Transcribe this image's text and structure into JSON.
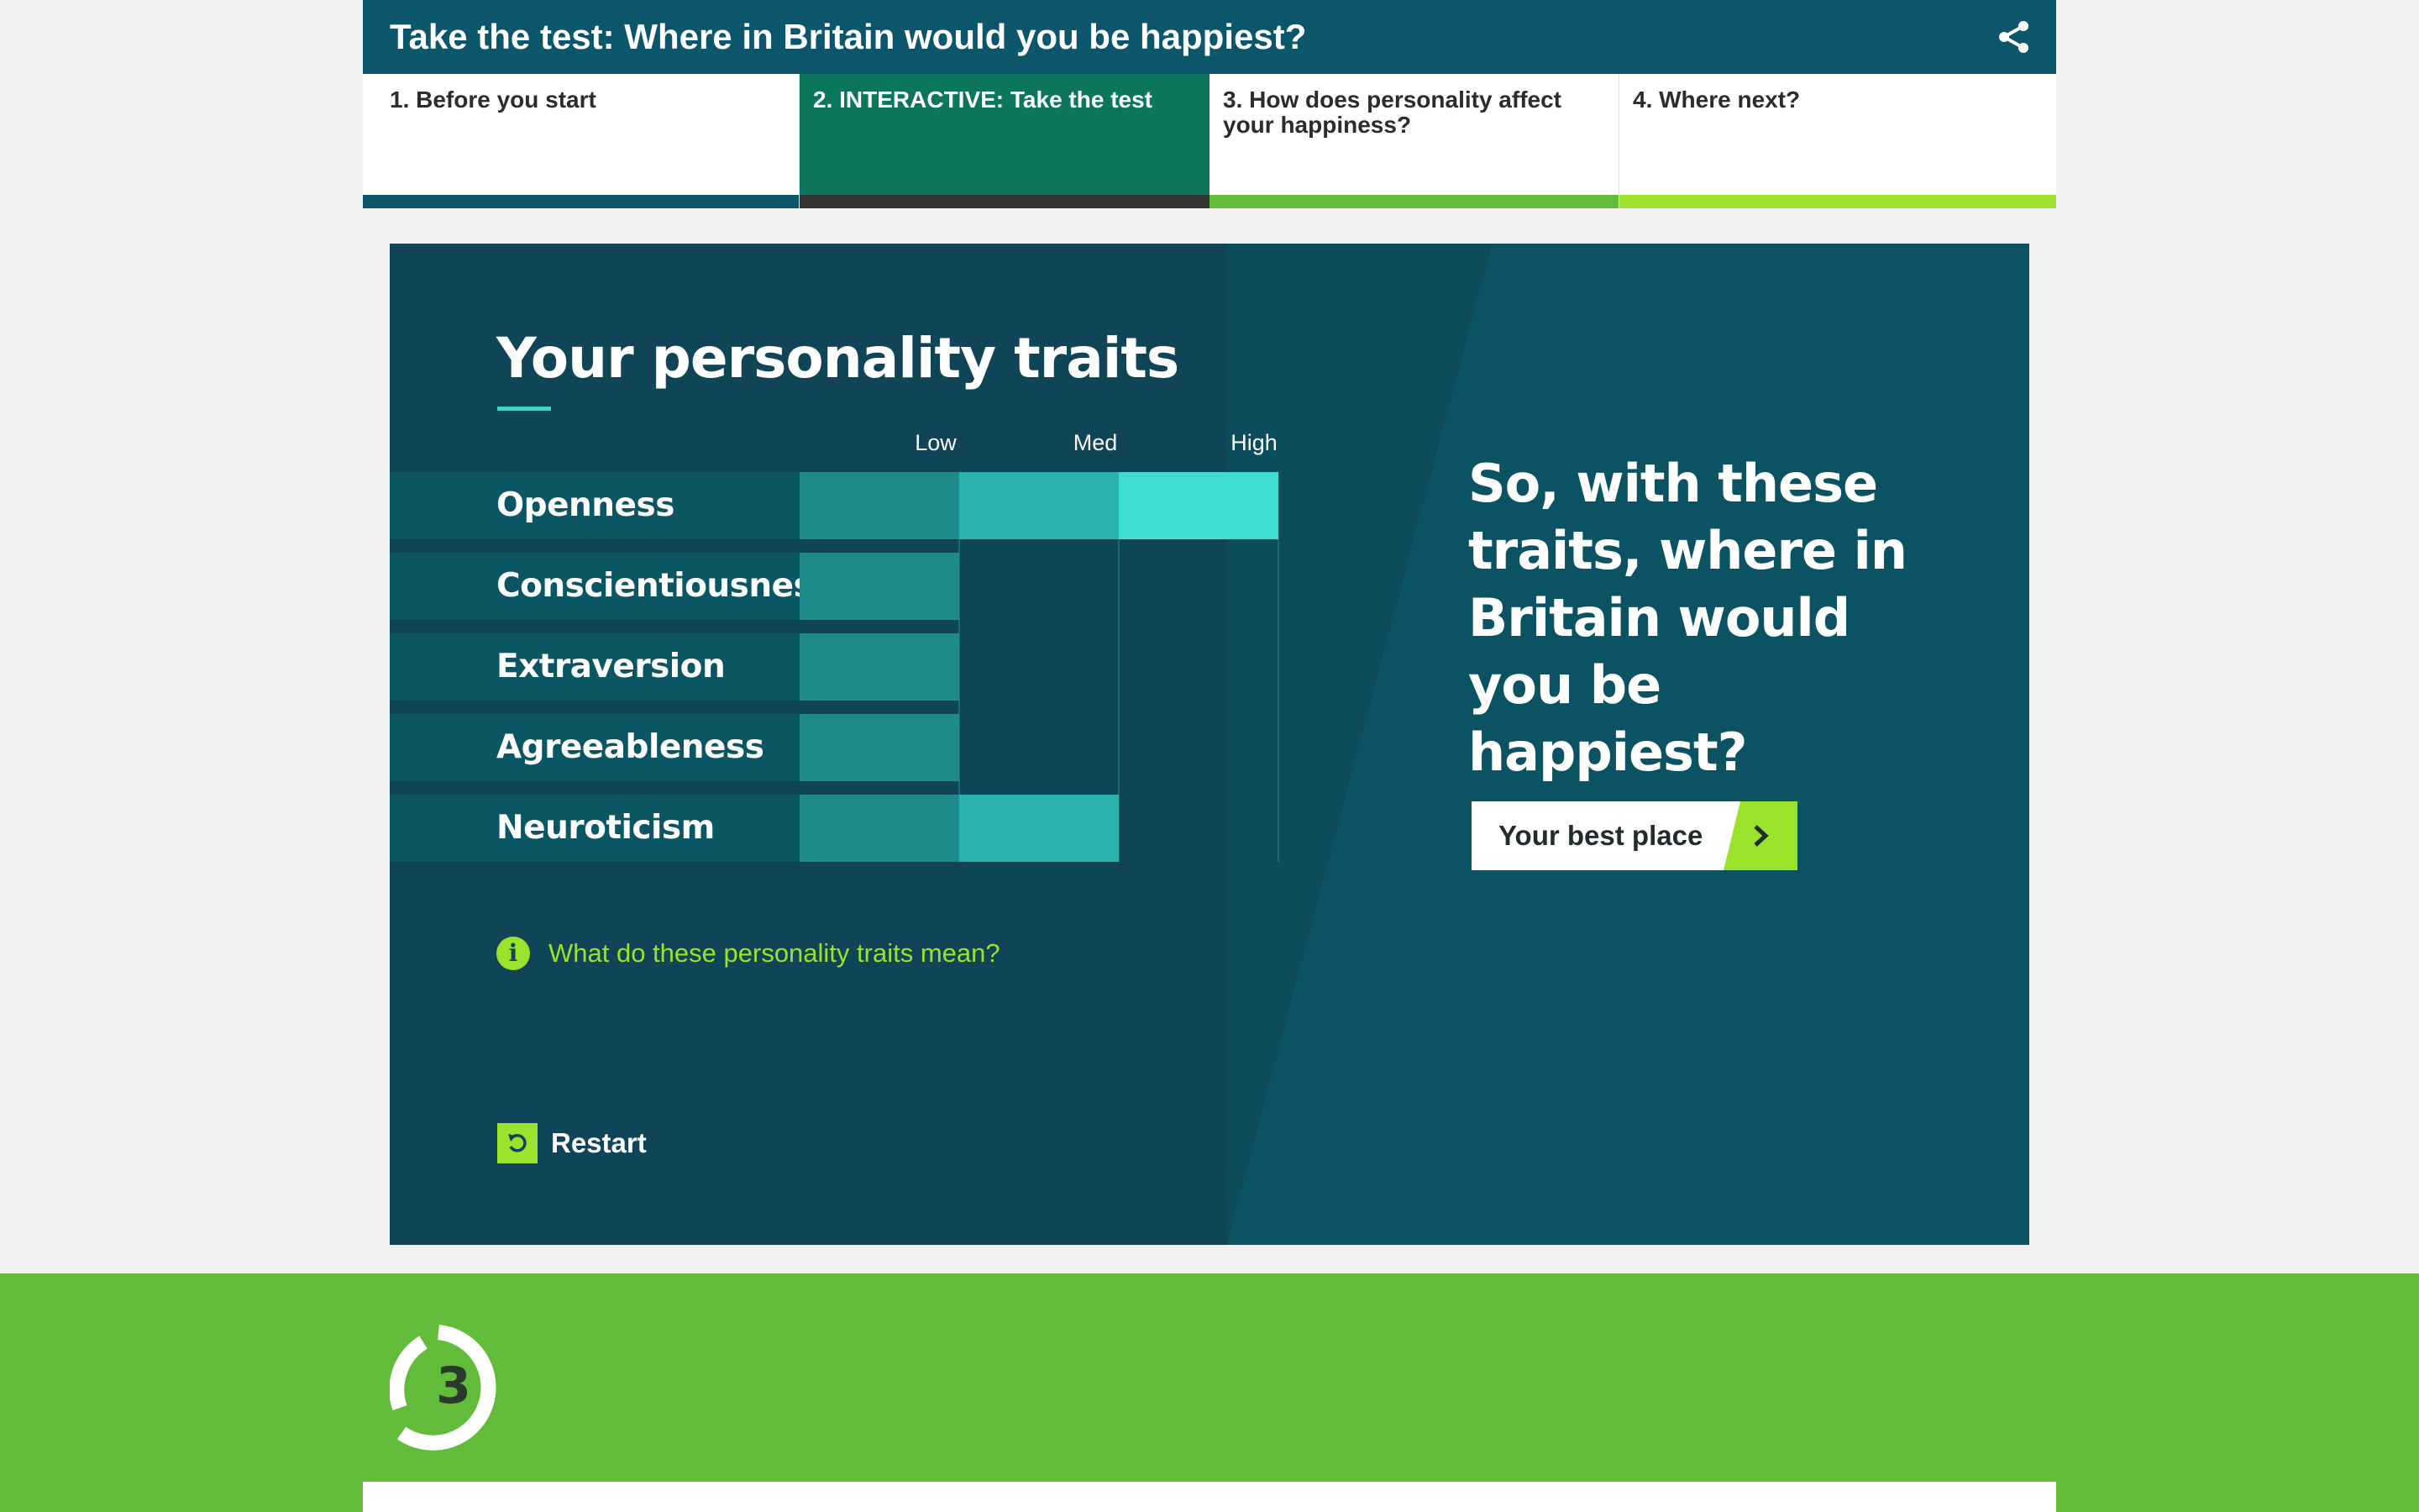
{
  "header": {
    "title": "Take the test: Where in Britain would you be happiest?",
    "share_icon": "share-icon"
  },
  "tabs": [
    {
      "label": "1. Before you start",
      "active": false,
      "bar_color": "#0b566a"
    },
    {
      "label": "2. INTERACTIVE: Take the test",
      "active": true,
      "bar_color": "#333333"
    },
    {
      "label": "3. How does personality affect your happiness?",
      "active": false,
      "bar_color": "#62bc3a"
    },
    {
      "label": "4. Where next?",
      "active": false,
      "bar_color": "#9be22c"
    }
  ],
  "traits_panel": {
    "title": "Your personality traits",
    "scale_labels": [
      "Low",
      "Med",
      "High"
    ],
    "traits": [
      {
        "name": "Openness",
        "level": "High",
        "level_index": 3
      },
      {
        "name": "Conscientiousness",
        "level": "Low",
        "level_index": 1
      },
      {
        "name": "Extraversion",
        "level": "Low",
        "level_index": 1
      },
      {
        "name": "Agreeableness",
        "level": "Low",
        "level_index": 1
      },
      {
        "name": "Neuroticism",
        "level": "Med",
        "level_index": 2
      }
    ],
    "info_link": "What do these personality traits mean?",
    "info_icon": "info-icon",
    "restart_label": "Restart",
    "restart_icon": "restart-icon"
  },
  "result_prompt": {
    "question": "So, with these traits, where in Britain would you be happiest?",
    "button_label": "Your best place",
    "button_icon": "chevron-right-icon"
  },
  "next_section": {
    "badge_number": "3",
    "badge_icon": "chapter-3-icon"
  },
  "colors": {
    "header_bg": "#0b566a",
    "panel_bg": "#0b5363",
    "accent_green": "#9be22c",
    "band_green": "#62bc3a",
    "bar_low": "#1f8a8a",
    "bar_med": "#2bb2ae",
    "bar_high": "#3fdcd0"
  }
}
